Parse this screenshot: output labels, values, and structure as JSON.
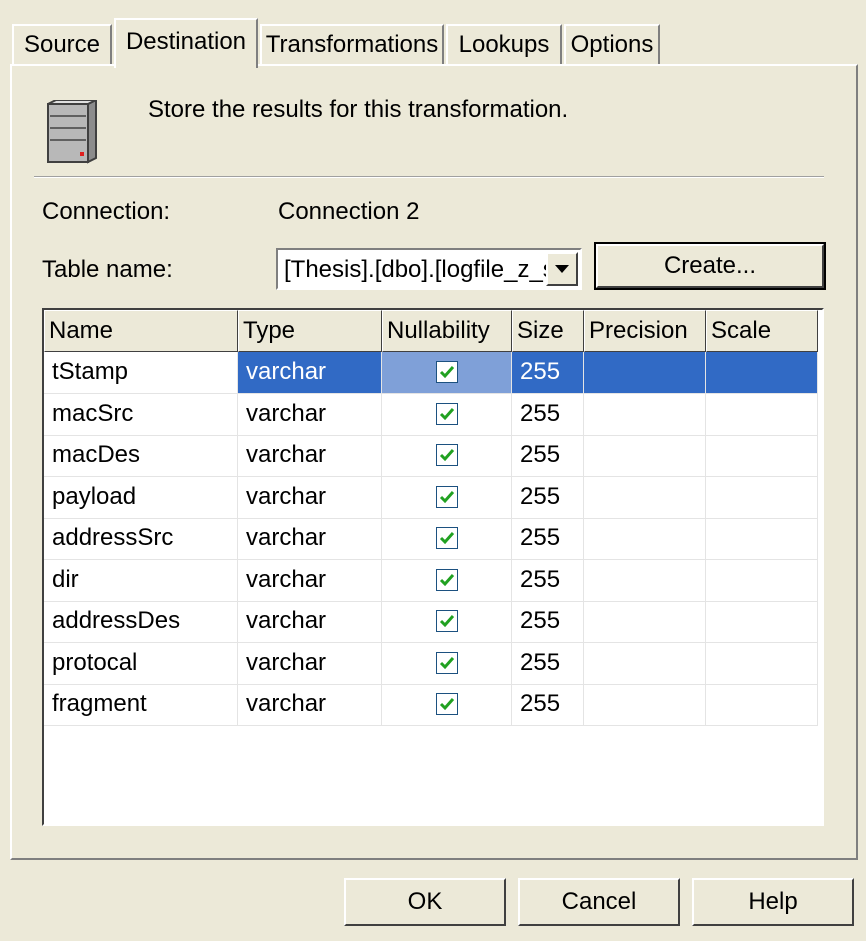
{
  "tabs": [
    {
      "label": "Source",
      "active": false
    },
    {
      "label": "Destination",
      "active": true
    },
    {
      "label": "Transformations",
      "active": false
    },
    {
      "label": "Lookups",
      "active": false
    },
    {
      "label": "Options",
      "active": false
    }
  ],
  "header": {
    "icon": "server-icon",
    "description": "Store the results for this transformation."
  },
  "connection": {
    "label": "Connection:",
    "value": "Connection 2"
  },
  "table_name": {
    "label": "Table name:",
    "value": "[Thesis].[dbo].[logfile_z_s",
    "create_label": "Create..."
  },
  "grid": {
    "columns": [
      "Name",
      "Type",
      "Nullability",
      "Size",
      "Precision",
      "Scale"
    ],
    "selected_row": 0,
    "rows": [
      {
        "name": "tStamp",
        "type": "varchar",
        "nullable": true,
        "size": "255",
        "precision": "",
        "scale": ""
      },
      {
        "name": "macSrc",
        "type": "varchar",
        "nullable": true,
        "size": "255",
        "precision": "",
        "scale": ""
      },
      {
        "name": "macDes",
        "type": "varchar",
        "nullable": true,
        "size": "255",
        "precision": "",
        "scale": ""
      },
      {
        "name": "payload",
        "type": "varchar",
        "nullable": true,
        "size": "255",
        "precision": "",
        "scale": ""
      },
      {
        "name": "addressSrc",
        "type": "varchar",
        "nullable": true,
        "size": "255",
        "precision": "",
        "scale": ""
      },
      {
        "name": "dir",
        "type": "varchar",
        "nullable": true,
        "size": "255",
        "precision": "",
        "scale": ""
      },
      {
        "name": "addressDes",
        "type": "varchar",
        "nullable": true,
        "size": "255",
        "precision": "",
        "scale": ""
      },
      {
        "name": "protocal",
        "type": "varchar",
        "nullable": true,
        "size": "255",
        "precision": "",
        "scale": ""
      },
      {
        "name": "fragment",
        "type": "varchar",
        "nullable": true,
        "size": "255",
        "precision": "",
        "scale": ""
      }
    ]
  },
  "footer": {
    "ok_label": "OK",
    "cancel_label": "Cancel",
    "help_label": "Help"
  },
  "colors": {
    "dialog_bg": "#ece9d8",
    "selection": "#316ac5",
    "checkbox_check": "#21a121"
  }
}
